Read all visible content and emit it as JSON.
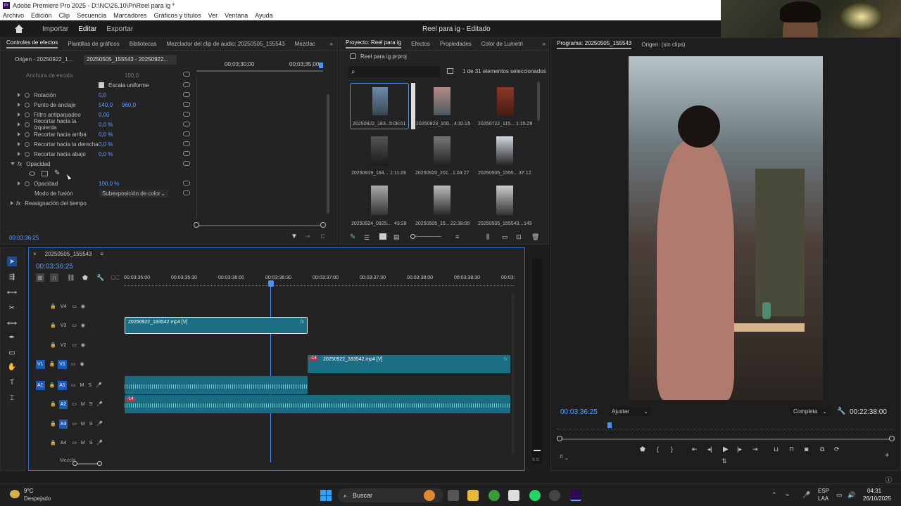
{
  "window": {
    "title": "Adobe Premiere Pro 2025 - D:\\NC\\26.10\\Pr\\Reel para ig *",
    "project_title": "Reel para ig - Editado"
  },
  "menu": [
    "Archivo",
    "Edición",
    "Clip",
    "Secuencia",
    "Marcadores",
    "Gráficos y títulos",
    "Ver",
    "Ventana",
    "Ayuda"
  ],
  "workspace": {
    "import": "Importar",
    "edit": "Editar",
    "export": "Exportar"
  },
  "effects_panel": {
    "tabs": [
      "Controles de efectos",
      "Plantillas de gráficos",
      "Bibliotecas",
      "Mezclador del clip de audio: 20250505_155543",
      "Mezclac"
    ],
    "source_label": "Origen - 20250922_1...",
    "clip_label": "20250505_155543 - 20250922...",
    "timecode_top": "00;03;30;00",
    "timecode_top2": "00;03;35;00",
    "uniform_scale": "Escala uniforme",
    "params": [
      {
        "name": "Anchura de escala",
        "value": "100,0",
        "value2": ""
      },
      {
        "name": "Rotación",
        "value": "0,0",
        "value2": ""
      },
      {
        "name": "Punto de anclaje",
        "value": "540,0",
        "value2": "960,0"
      },
      {
        "name": "Filtro antiparpadeo",
        "value": "0,00",
        "value2": ""
      },
      {
        "name": "Recortar hacia la izquierda",
        "value": "0,0 %",
        "value2": ""
      },
      {
        "name": "Recortar hacia arriba",
        "value": "0,0 %",
        "value2": ""
      },
      {
        "name": "Recortar hacia la derecha",
        "value": "0,0 %",
        "value2": ""
      },
      {
        "name": "Recortar hacia abajo",
        "value": "0,0 %",
        "value2": ""
      }
    ],
    "opacity_section": "Opacidad",
    "opacity_label": "Opacidad",
    "opacity_value": "100,0 %",
    "blend_label": "Modo de fusión",
    "blend_value": "Subexposición de color",
    "time_remap": "Reasignación del tiempo",
    "timecode_bottom": "00:03:36:25"
  },
  "project_panel": {
    "tabs": [
      "Proyecto: Reel para ig",
      "Efectos",
      "Propiedades",
      "Color de Lumetri"
    ],
    "file": "Reel para ig.prproj",
    "selection": "1 de 31 elementos seleccionados",
    "items": [
      {
        "name": "20250922_183...",
        "duration": "5:08:01"
      },
      {
        "name": "20250923_100...",
        "duration": "4:32:25"
      },
      {
        "name": "20250722_115...",
        "duration": "1:15:29"
      },
      {
        "name": "20250919_184...",
        "duration": "1:11:28"
      },
      {
        "name": "20250920_201...",
        "duration": "1:04:27"
      },
      {
        "name": "20250505_1555...",
        "duration": "37:12"
      },
      {
        "name": "20250924_0925...",
        "duration": "43:28"
      },
      {
        "name": "20250505_15...",
        "duration": "22:38:00"
      },
      {
        "name": "20250505_155543...",
        "duration": "149"
      }
    ]
  },
  "program_panel": {
    "tabs": [
      "Programa: 20250505_155543",
      "Origen: (sin clips)"
    ],
    "timecode": "00:03:36:25",
    "fit": "Ajustar",
    "quality": "Completa",
    "duration": "00:22:38:00"
  },
  "timeline": {
    "sequence": "20250505_155543",
    "timecode": "00:03:36:25",
    "ruler": [
      "00:03:35:00",
      "00:03:35:30",
      "00:03:36:00",
      "00:03:36:30",
      "00:03:37:00",
      "00:03:37:30",
      "00:03:38:00",
      "00:03:38:30",
      "00:03:"
    ],
    "video_tracks": [
      "V4",
      "V3",
      "V2",
      "V1"
    ],
    "audio_tracks": [
      "A1",
      "A2",
      "A3",
      "A4"
    ],
    "clip_v3": "20250922_183542.mp4 [V]",
    "clip_v1": "20250922_183542.mp4 [V]",
    "clip_badge": "-14",
    "audio_badge": "-14",
    "track_m": "M",
    "track_s": "S",
    "meter_label": "S S",
    "sub_label": "Mezcla"
  },
  "taskbar": {
    "weather_temp": "9°C",
    "weather_desc": "Despejado",
    "search": "Buscar",
    "lang_top": "ESP",
    "lang_bottom": "LAA",
    "time": "04:31",
    "date": "26/10/2025"
  },
  "colors": {
    "accent": "#2d8ceb",
    "clip_teal": "#1c6e85",
    "audio_teal": "#1b6b82"
  }
}
